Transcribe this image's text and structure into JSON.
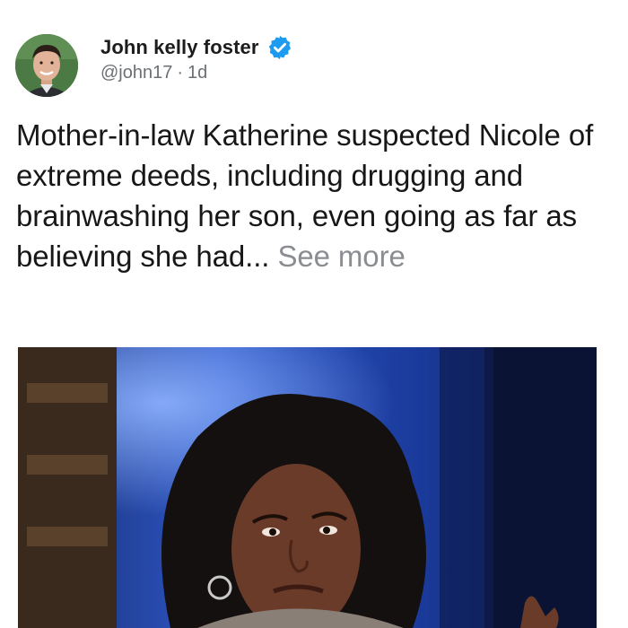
{
  "author": {
    "display_name": "John kelly foster",
    "handle": "@john17",
    "separator": "·",
    "time_ago": "1d",
    "verified": true
  },
  "tweet": {
    "text": "Mother-in-law Katherine suspected Nicole of extreme deeds, including drugging and brainwashing her son, even going as far as believing she had... ",
    "see_more_label": "See more"
  },
  "icons": {
    "verified": "verified-badge-icon"
  },
  "colors": {
    "verified_blue": "#1d9bf0",
    "see_more_gray": "#8a8d91",
    "text_dark": "#171717"
  }
}
